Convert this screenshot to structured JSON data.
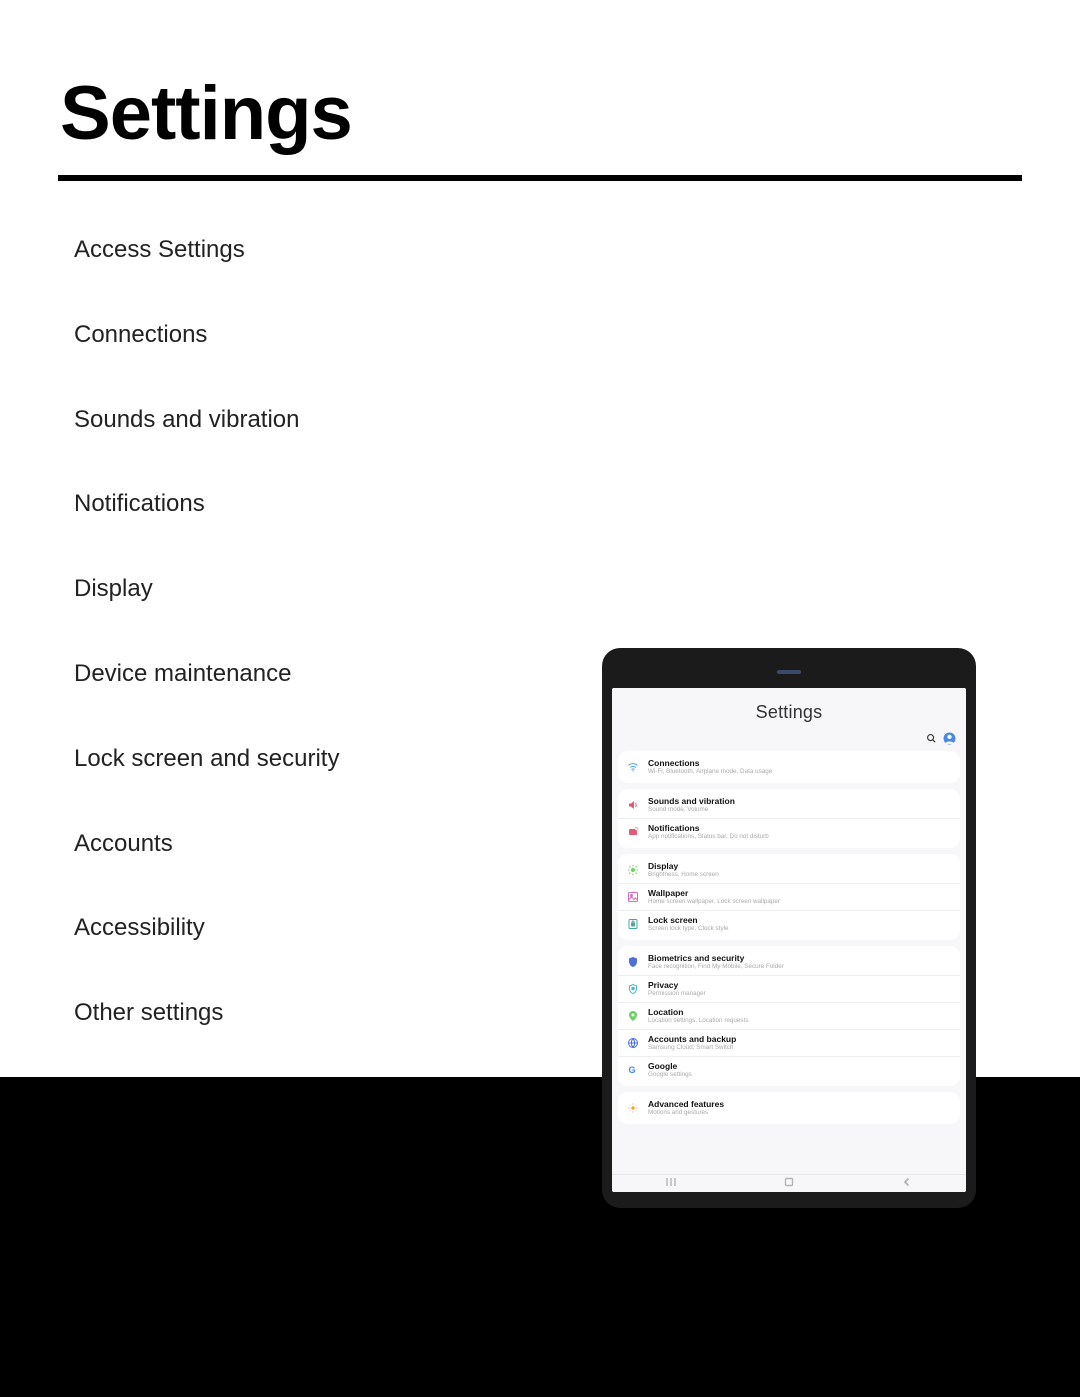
{
  "page": {
    "title": "Settings"
  },
  "toc": [
    "Access Settings",
    "Connections",
    "Sounds and vibration",
    "Notifications",
    "Display",
    "Device maintenance",
    "Lock screen and security",
    "Accounts",
    "Accessibility",
    "Other settings"
  ],
  "tablet": {
    "header": "Settings",
    "groups": [
      {
        "items": [
          {
            "title": "Connections",
            "sub": "Wi-Fi, Bluetooth, Airplane mode, Data usage",
            "icon": "wifi",
            "color": "#5aa7e8"
          }
        ]
      },
      {
        "items": [
          {
            "title": "Sounds and vibration",
            "sub": "Sound mode, Volume",
            "icon": "sound",
            "color": "#e05a78"
          },
          {
            "title": "Notifications",
            "sub": "App notifications, Status bar, Do not disturb",
            "icon": "notif",
            "color": "#e05a78"
          }
        ]
      },
      {
        "items": [
          {
            "title": "Display",
            "sub": "Brightness, Home screen",
            "icon": "display",
            "color": "#6fcf63"
          },
          {
            "title": "Wallpaper",
            "sub": "Home screen wallpaper, Lock screen wallpaper",
            "icon": "wallpaper",
            "color": "#d86ac3"
          },
          {
            "title": "Lock screen",
            "sub": "Screen lock type, Clock style",
            "icon": "lock",
            "color": "#4aa5a0"
          }
        ]
      },
      {
        "items": [
          {
            "title": "Biometrics and security",
            "sub": "Face recognition, Find My Mobile, Secure Folder",
            "icon": "shield",
            "color": "#4f6fd6"
          },
          {
            "title": "Privacy",
            "sub": "Permission manager",
            "icon": "privacy",
            "color": "#49b7c6"
          },
          {
            "title": "Location",
            "sub": "Location settings, Location requests",
            "icon": "location",
            "color": "#6fcf63"
          },
          {
            "title": "Accounts and backup",
            "sub": "Samsung Cloud, Smart Switch",
            "icon": "accounts",
            "color": "#4f6fd6"
          },
          {
            "title": "Google",
            "sub": "Google settings",
            "icon": "google",
            "color": "#4285F4"
          }
        ]
      },
      {
        "items": [
          {
            "title": "Advanced features",
            "sub": "Motions and gestures",
            "icon": "advanced",
            "color": "#f0a33a"
          }
        ]
      }
    ]
  }
}
